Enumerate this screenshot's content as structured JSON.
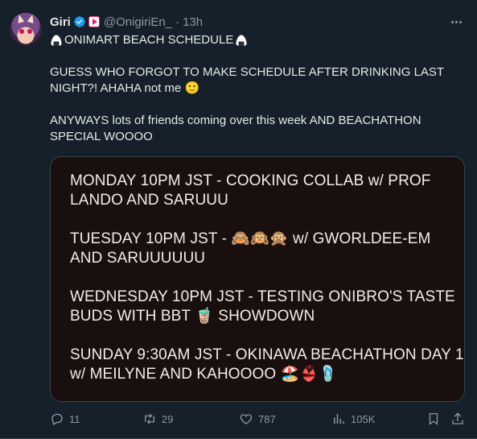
{
  "user": {
    "name": "Giri",
    "handle": "@OnigiriEn_",
    "separator": "·",
    "time": "13h"
  },
  "tweet": {
    "title": "ONIMART BEACH SCHEDULE",
    "line2": "GUESS WHO FORGOT TO MAKE SCHEDULE AFTER DRINKING LAST NIGHT?! AHAHA not me 🙂",
    "line3": "ANYWAYS lots of friends coming over this week AND BEACHATHON SPECIAL WOOOO"
  },
  "schedule": [
    {
      "text": "MONDAY 10PM JST - COOKING COLLAB w/ PROF LANDO AND SARUUU"
    },
    {
      "text": "TUESDAY 10PM JST - 🙈🙉🙊 w/ GWORLDEE-EM AND SARUUUUUU"
    },
    {
      "text": "WEDNESDAY 10PM JST - TESTING ONIBRO'S TASTE BUDS WITH BBT 🧋 SHOWDOWN"
    },
    {
      "text": "SUNDAY 9:30AM JST - OKINAWA BEACHATHON DAY 1 w/ MEILYNE AND KAHOOOO 🏖️👙🩴"
    }
  ],
  "actions": {
    "replies": "11",
    "retweets": "29",
    "likes": "787",
    "views": "105K"
  },
  "colors": {
    "background": "#15202b",
    "verified": "#1d9bf0",
    "muted": "#8b98a5",
    "card": "#1a0f0f"
  },
  "icons": [
    "verified-badge-icon",
    "affiliate-badge-icon",
    "more-icon",
    "onigiri-icon",
    "reply-icon",
    "retweet-icon",
    "like-icon",
    "views-icon",
    "bookmark-icon",
    "share-icon"
  ]
}
